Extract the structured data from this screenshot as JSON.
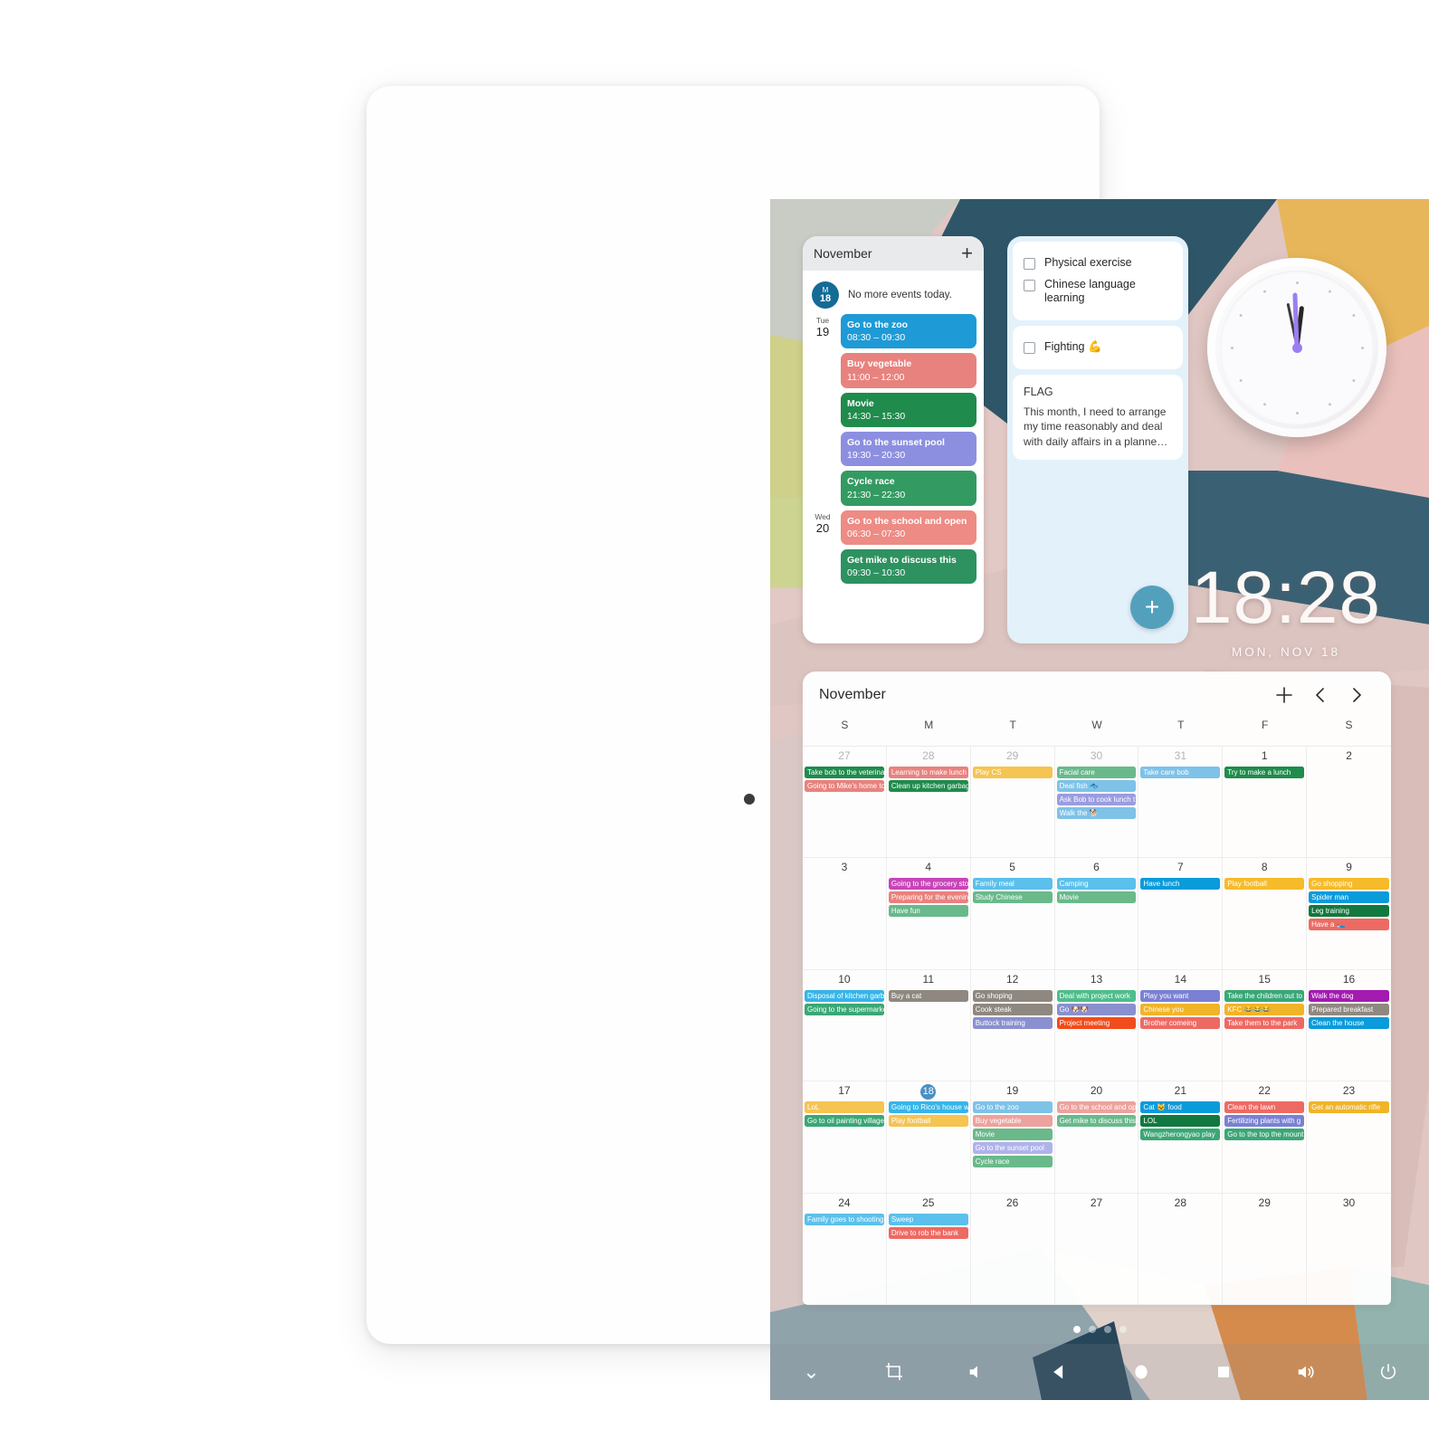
{
  "device": {
    "name": "tablet"
  },
  "statusbar": {
    "time": "18:28",
    "date": "MON, NOV 18"
  },
  "agenda_widget": {
    "month": "November",
    "add_label": "+",
    "today": {
      "month_abbr": "M",
      "day": "18"
    },
    "today_note": "No more events today.",
    "days": [
      {
        "dow": "Tue",
        "num": "19",
        "events": [
          {
            "title": "Go to the zoo",
            "time": "08:30 – 09:30",
            "color": "#1e9ad6"
          },
          {
            "title": "Buy vegetable",
            "time": "11:00 – 12:00",
            "color": "#e8827e"
          },
          {
            "title": "Movie",
            "time": "14:30 – 15:30",
            "color": "#1f8b4c"
          },
          {
            "title": "Go to the sunset pool",
            "time": "19:30 – 20:30",
            "color": "#8c8fe0"
          },
          {
            "title": "Cycle race",
            "time": "21:30 – 22:30",
            "color": "#339a62"
          }
        ]
      },
      {
        "dow": "Wed",
        "num": "20",
        "events": [
          {
            "title": "Go to the school and open",
            "time": "06:30 – 07:30",
            "color": "#ed8b84"
          },
          {
            "title": "Get mike to discuss this",
            "time": "09:30 – 10:30",
            "color": "#2e9160"
          }
        ]
      }
    ]
  },
  "tasks_widget": {
    "tasks_card_1": [
      {
        "label": "Physical exercise",
        "checked": false
      },
      {
        "label": "Chinese language learning",
        "checked": false
      }
    ],
    "tasks_card_2": [
      {
        "label": "Fighting 💪",
        "checked": false
      }
    ],
    "note": {
      "title": "FLAG",
      "body": "This month, I need to arrange my time reasonably and deal with daily affairs in a planne…"
    },
    "fab_label": "+"
  },
  "clock_widget": {
    "hour_deg": 187,
    "minute_deg": 268,
    "second_deg": 168,
    "minute_hand_color": "#9b7ff0",
    "hour_hand_color": "#262626"
  },
  "calendar": {
    "title": "November",
    "add_label": "+",
    "prev_label": "‹",
    "next_label": "›",
    "dow": [
      "S",
      "M",
      "T",
      "W",
      "T",
      "F",
      "S"
    ],
    "today": 18,
    "weeks": [
      [
        {
          "day": "27",
          "other": true,
          "events": [
            {
              "title": "Take bob to the veterinary",
              "color": "#1f8b4c"
            },
            {
              "title": "Going to Mike's home to",
              "color": "#e8827e"
            }
          ]
        },
        {
          "day": "28",
          "other": true,
          "events": [
            {
              "title": "Learning to make lunch",
              "color": "#e8827e"
            },
            {
              "title": "Clean up kitchen garbage",
              "color": "#1f8b4c"
            }
          ]
        },
        {
          "day": "29",
          "other": true,
          "events": [
            {
              "title": "Play CS",
              "color": "#f5c451"
            }
          ]
        },
        {
          "day": "30",
          "other": true,
          "events": [
            {
              "title": "Facial care",
              "color": "#69b98b"
            },
            {
              "title": "Deal fish 🐟",
              "color": "#7ec2e8"
            },
            {
              "title": "Ask Bob to cook lunch t",
              "color": "#9a9ce0"
            },
            {
              "title": "Walk the 🐕",
              "color": "#7ec2e8"
            }
          ]
        },
        {
          "day": "31",
          "other": true,
          "events": [
            {
              "title": "Take care bob",
              "color": "#7ec2e8"
            }
          ]
        },
        {
          "day": "1",
          "other": false,
          "events": [
            {
              "title": "Try to make a lunch",
              "color": "#1f8b4c"
            }
          ]
        },
        {
          "day": "2",
          "other": false,
          "events": []
        }
      ],
      [
        {
          "day": "3",
          "other": false,
          "events": []
        },
        {
          "day": "4",
          "other": false,
          "events": [
            {
              "title": "Going to the grocery store",
              "color": "#c845b8"
            },
            {
              "title": "Preparing for the evening",
              "color": "#e8827e"
            },
            {
              "title": "Have fun",
              "color": "#69b98b"
            }
          ]
        },
        {
          "day": "5",
          "other": false,
          "events": [
            {
              "title": "Family meal",
              "color": "#5bc0eb"
            },
            {
              "title": "Study Chinese",
              "color": "#69b98b"
            }
          ]
        },
        {
          "day": "6",
          "other": false,
          "events": [
            {
              "title": "Camping",
              "color": "#5bc0eb"
            },
            {
              "title": "Movie",
              "color": "#69b98b"
            }
          ]
        },
        {
          "day": "7",
          "other": false,
          "events": [
            {
              "title": "Have lunch",
              "color": "#0a9bdb"
            }
          ]
        },
        {
          "day": "8",
          "other": false,
          "events": [
            {
              "title": "Play football",
              "color": "#f5bb2a"
            }
          ]
        },
        {
          "day": "9",
          "other": false,
          "events": [
            {
              "title": "Go shopping",
              "color": "#f5bb2a"
            },
            {
              "title": "Spider man",
              "color": "#0a9bdb"
            },
            {
              "title": "Leg training",
              "color": "#11793f"
            },
            {
              "title": "Have a 🛌",
              "color": "#ed6a63"
            }
          ]
        }
      ],
      [
        {
          "day": "10",
          "other": false,
          "events": [
            {
              "title": "Disposal of kitchen garbage",
              "color": "#36b5e8"
            },
            {
              "title": "Going to the supermarket",
              "color": "#3aa776"
            }
          ]
        },
        {
          "day": "11",
          "other": false,
          "events": [
            {
              "title": "Buy a cat",
              "color": "#8f8880"
            }
          ]
        },
        {
          "day": "12",
          "other": false,
          "events": [
            {
              "title": "Go shoping",
              "color": "#8f8880"
            },
            {
              "title": "Cook steak",
              "color": "#8f8880"
            },
            {
              "title": "Buttock training",
              "color": "#8a90cf"
            }
          ]
        },
        {
          "day": "13",
          "other": false,
          "events": [
            {
              "title": "Deal with project work",
              "color": "#4fbd8a"
            },
            {
              "title": "Go 🐶🐶",
              "color": "#8a90cf"
            },
            {
              "title": "Project meeting",
              "color": "#f24c1c"
            }
          ]
        },
        {
          "day": "14",
          "other": false,
          "events": [
            {
              "title": "Play you want",
              "color": "#7a81d4"
            },
            {
              "title": "Chinese you",
              "color": "#f0b429"
            },
            {
              "title": "Brother comeing",
              "color": "#ed6a63"
            }
          ]
        },
        {
          "day": "15",
          "other": false,
          "events": [
            {
              "title": "Take the children out to",
              "color": "#3aa776"
            },
            {
              "title": "KFC 😂😂😂",
              "color": "#f0b429"
            },
            {
              "title": "Take them to the park",
              "color": "#ed6a63"
            }
          ]
        },
        {
          "day": "16",
          "other": false,
          "events": [
            {
              "title": "Walk the dog",
              "color": "#a31bb0"
            },
            {
              "title": "Prepared breakfast",
              "color": "#8f8880"
            },
            {
              "title": "Clean the house",
              "color": "#0a9bdb"
            }
          ]
        }
      ],
      [
        {
          "day": "17",
          "other": false,
          "events": [
            {
              "title": "LoL",
              "color": "#f5c451"
            },
            {
              "title": "Go to oil painting village",
              "color": "#3aa776"
            }
          ]
        },
        {
          "day": "18",
          "other": false,
          "today": true,
          "events": [
            {
              "title": "Going to Rico's house w",
              "color": "#36b5e8"
            },
            {
              "title": "Play football",
              "color": "#f5c451"
            }
          ]
        },
        {
          "day": "19",
          "other": false,
          "events": [
            {
              "title": "Go to the zoo",
              "color": "#7ec2e8"
            },
            {
              "title": "Buy vegetable",
              "color": "#eda29d"
            },
            {
              "title": "Movie",
              "color": "#69b98b"
            },
            {
              "title": "Go to the sunset pool",
              "color": "#b0b3ea"
            },
            {
              "title": "Cycle race",
              "color": "#69b98b"
            }
          ]
        },
        {
          "day": "20",
          "other": false,
          "events": [
            {
              "title": "Go to the school and op",
              "color": "#eda29d"
            },
            {
              "title": "Get mike to discuss this",
              "color": "#69b98b"
            }
          ]
        },
        {
          "day": "21",
          "other": false,
          "events": [
            {
              "title": "Cat 🐱 food",
              "color": "#0a9bdb"
            },
            {
              "title": "LOL",
              "color": "#11793f"
            },
            {
              "title": "Wangzherongyao play",
              "color": "#3aa776"
            }
          ]
        },
        {
          "day": "22",
          "other": false,
          "events": [
            {
              "title": "Clean the lawn",
              "color": "#ed6a63"
            },
            {
              "title": "Fertilizing plants with g",
              "color": "#7a81d4"
            },
            {
              "title": "Go to the top the mount",
              "color": "#3aa776"
            }
          ]
        },
        {
          "day": "23",
          "other": false,
          "events": [
            {
              "title": "Get an automatic rifle",
              "color": "#f0b429"
            }
          ]
        }
      ],
      [
        {
          "day": "24",
          "other": false,
          "events": [
            {
              "title": "Family goes to shooting",
              "color": "#5bc0eb"
            }
          ]
        },
        {
          "day": "25",
          "other": false,
          "events": [
            {
              "title": "Sweep",
              "color": "#5bc0eb"
            },
            {
              "title": "Drive to rob the bank",
              "color": "#ed6a63"
            }
          ]
        },
        {
          "day": "26",
          "other": false,
          "events": []
        },
        {
          "day": "27",
          "other": false,
          "events": []
        },
        {
          "day": "28",
          "other": false,
          "events": []
        },
        {
          "day": "29",
          "other": false,
          "events": []
        },
        {
          "day": "30",
          "other": false,
          "events": []
        }
      ]
    ]
  },
  "page_dots": {
    "count": 4,
    "active": 0
  },
  "navbar": {
    "buttons": [
      {
        "name": "collapse-chevron-icon",
        "glyph": "⌄"
      },
      {
        "name": "screenshot-crop-icon",
        "glyph": "crop"
      },
      {
        "name": "volume-down-icon",
        "glyph": "voldown"
      },
      {
        "name": "back-icon",
        "glyph": "back"
      },
      {
        "name": "home-icon",
        "glyph": "home"
      },
      {
        "name": "recents-icon",
        "glyph": "recents"
      },
      {
        "name": "volume-up-icon",
        "glyph": "volup"
      },
      {
        "name": "power-icon",
        "glyph": "power"
      }
    ]
  }
}
